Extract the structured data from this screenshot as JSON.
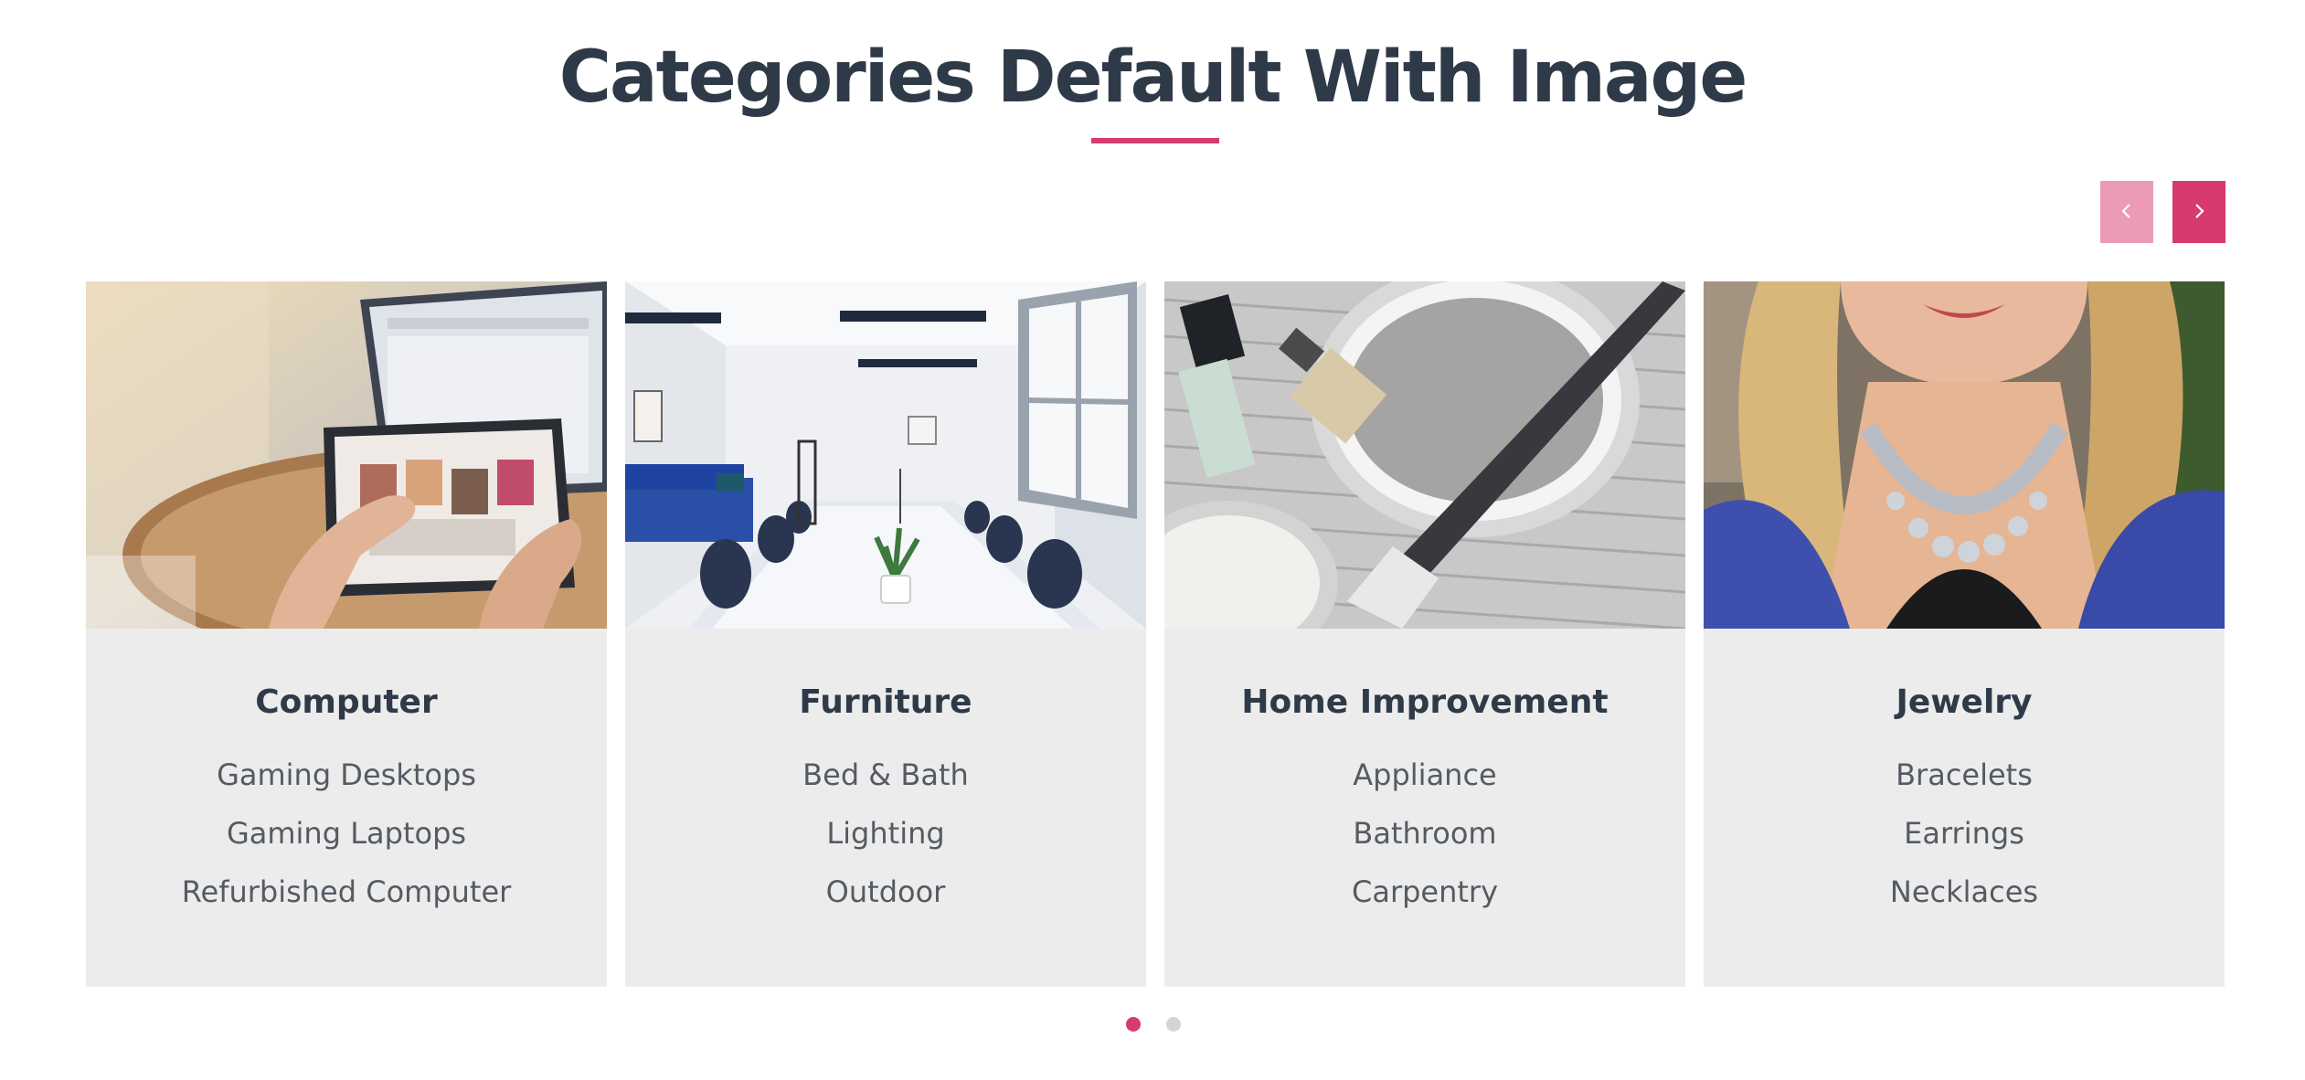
{
  "section": {
    "title": "Categories Default With Image",
    "accent_color": "#d63a6e",
    "heading_color": "#2f3a49"
  },
  "carousel": {
    "prev_icon": "chevron-left-icon",
    "next_icon": "chevron-right-icon",
    "active_page": 1,
    "page_count": 2
  },
  "cards": [
    {
      "title": "Computer",
      "image": "photo of hands using a tablet in front of a laptop",
      "items": [
        "Gaming Desktops",
        "Gaming Laptops",
        "Refurbished Computer"
      ]
    },
    {
      "title": "Furniture",
      "image": "photo of a bright meeting room with a white table, chairs and a blue sofa",
      "items": [
        "Bed & Bath",
        "Lighting",
        "Outdoor"
      ]
    },
    {
      "title": "Home Improvement",
      "image": "photo of paint cans and brushes on newspaper",
      "items": [
        "Appliance",
        "Bathroom",
        "Carpentry"
      ]
    },
    {
      "title": "Jewelry",
      "image": "photo of a smiling woman wearing a silver statement necklace",
      "items": [
        "Bracelets",
        "Earrings",
        "Necklaces"
      ]
    }
  ]
}
